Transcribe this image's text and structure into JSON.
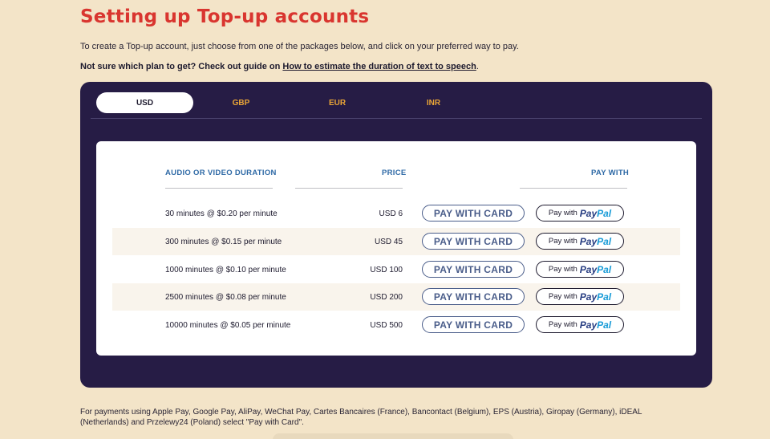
{
  "page": {
    "title": "Setting up Top-up accounts",
    "intro": "To create a Top-up account, just choose from one of the packages below, and click on your preferred way to pay.",
    "guide_prefix": "Not sure which plan to get? Check out guide on ",
    "guide_link": "How to estimate the duration of text to speech",
    "guide_suffix": "."
  },
  "tabs": [
    {
      "label": "USD",
      "active": true
    },
    {
      "label": "GBP",
      "active": false
    },
    {
      "label": "EUR",
      "active": false
    },
    {
      "label": "INR",
      "active": false
    }
  ],
  "table": {
    "headers": {
      "duration": "AUDIO OR VIDEO DURATION",
      "price": "PRICE",
      "pay_with": "PAY WITH"
    },
    "card_button_label": "PAY WITH CARD",
    "paypal_prefix": "Pay with",
    "paypal_logo_a": "Pay",
    "paypal_logo_b": "Pal",
    "rows": [
      {
        "duration": "30 minutes @ $0.20 per minute",
        "price": "USD 6"
      },
      {
        "duration": "300 minutes @ $0.15 per minute",
        "price": "USD 45"
      },
      {
        "duration": "1000 minutes @ $0.10 per minute",
        "price": "USD 100"
      },
      {
        "duration": "2500 minutes @ $0.08 per minute",
        "price": "USD 200"
      },
      {
        "duration": "10000 minutes @ $0.05 per minute",
        "price": "USD 500"
      }
    ]
  },
  "footnote": "For payments using Apple Pay, Google Pay, AliPay, WeChat Pay, Cartes Bancaires (France), Bancontact (Belgium), EPS (Austria), Giropay (Germany), iDEAL (Netherlands) and Przelewy24 (Poland) select \"Pay with Card\".",
  "colors": {
    "background": "#f3e4c8",
    "title": "#d9352f",
    "panel": "#261c45",
    "tab_inactive": "#e9a537",
    "header": "#2f6aa6",
    "card_button": "#4a5d8a"
  }
}
